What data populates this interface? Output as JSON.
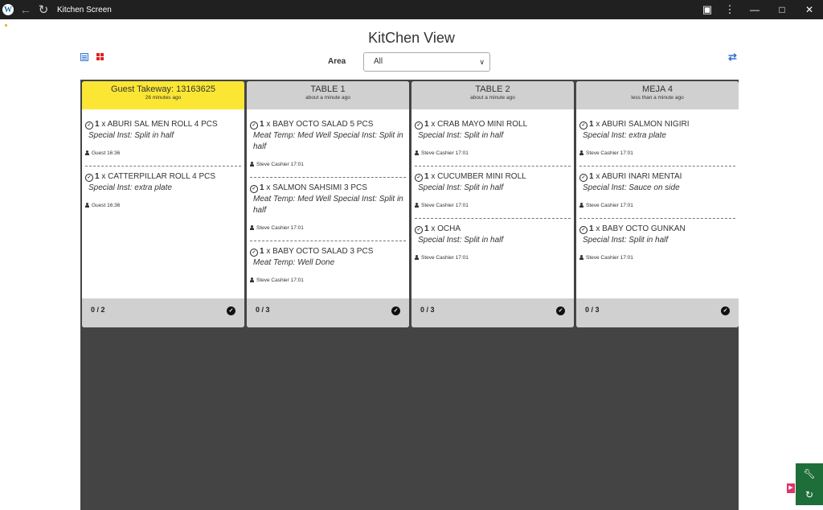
{
  "window": {
    "title": "Kitchen Screen",
    "app_icon": "wordpress-icon",
    "icons": [
      "back-arrow-icon",
      "reload-icon",
      "extensions-icon",
      "more-vertical-icon",
      "minimize-icon",
      "maximize-icon",
      "close-icon"
    ]
  },
  "page": {
    "title": "KitChen View",
    "area_label": "Area",
    "area_value": "All"
  },
  "tickets": [
    {
      "name": "Guest Takeway: 13163625",
      "time": "26 minutes ago",
      "highlight": true,
      "items": [
        {
          "qty": "1",
          "name": "ABURI SAL MEN ROLL 4 PCS",
          "notes": [
            "Special Inst: Split in half"
          ],
          "meta": "Guest 16:36"
        },
        {
          "qty": "1",
          "name": "CATTERPILLAR ROLL 4 PCS",
          "notes": [
            "Special Inst: extra plate"
          ],
          "meta": "Guest 16:36"
        }
      ],
      "count": "0 / 2"
    },
    {
      "name": "TABLE 1",
      "time": "about a minute ago",
      "highlight": false,
      "items": [
        {
          "qty": "1",
          "name": "BABY OCTO SALAD 5 PCS",
          "notes": [
            "Meat Temp: Med Well Special Inst: Split in half"
          ],
          "meta": "Steve Cashier 17:01"
        },
        {
          "qty": "1",
          "name": "SALMON SAHSIMI 3 PCS",
          "notes": [
            "Meat Temp: Med Well Special Inst: Split in half"
          ],
          "meta": "Steve Cashier 17:01"
        },
        {
          "qty": "1",
          "name": "BABY OCTO SALAD 3 PCS",
          "notes": [
            "Meat Temp: Well Done"
          ],
          "meta": "Steve Cashier 17:01"
        }
      ],
      "count": "0 / 3"
    },
    {
      "name": "TABLE 2",
      "time": "about a minute ago",
      "highlight": false,
      "items": [
        {
          "qty": "1",
          "name": "CRAB MAYO MINI ROLL",
          "notes": [
            "Special Inst: Split in half"
          ],
          "meta": "Steve Cashier 17:01"
        },
        {
          "qty": "1",
          "name": "CUCUMBER MINI ROLL",
          "notes": [
            "Special Inst: Split in half"
          ],
          "meta": "Steve Cashier 17:01"
        },
        {
          "qty": "1",
          "name": "OCHA",
          "notes": [
            "Special Inst: Split in half"
          ],
          "meta": "Steve Cashier 17:01"
        }
      ],
      "count": "0 / 3"
    },
    {
      "name": "MEJA 4",
      "time": "less than a minute ago",
      "highlight": false,
      "items": [
        {
          "qty": "1",
          "name": "ABURI SALMON NIGIRI",
          "notes": [
            "Special Inst: extra plate"
          ],
          "meta": "Steve Cashier 17:01"
        },
        {
          "qty": "1",
          "name": "ABURI INARI MENTAI",
          "notes": [
            "Special Inst: Sauce on side"
          ],
          "meta": "Steve Cashier 17:01"
        },
        {
          "qty": "1",
          "name": "BABY OCTO GUNKAN",
          "notes": [
            "Special Inst: Split in half"
          ],
          "meta": "Steve Cashier 17:01"
        }
      ],
      "count": "0 / 3"
    }
  ],
  "labels": {
    "times": "x"
  },
  "colors": {
    "takeaway_header": "#fbe634",
    "board": "#444444",
    "fab": "#1e6e3a"
  }
}
